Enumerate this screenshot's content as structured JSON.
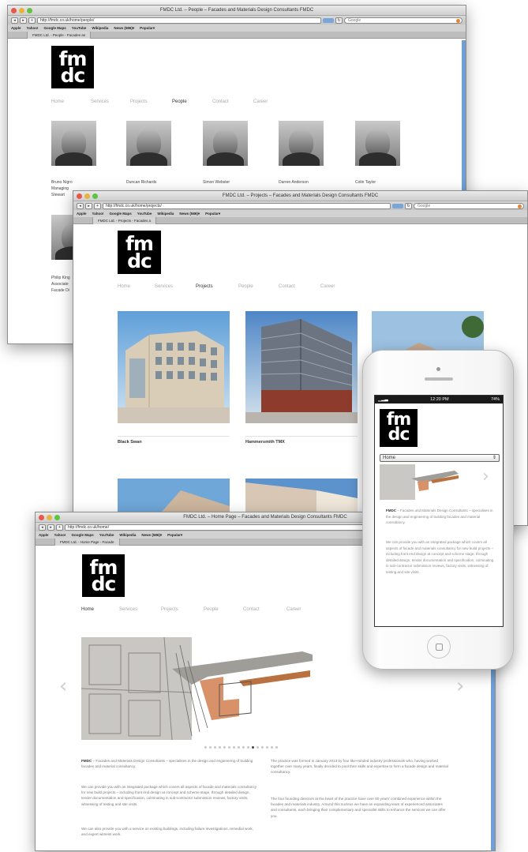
{
  "colors": {
    "scrollbar": "#6f9fd6",
    "logo_bg": "#000000",
    "nav_active": "#333333",
    "nav_inactive": "#aaaaaa"
  },
  "logo": {
    "line1": "fm",
    "line2": "dc"
  },
  "nav_items": [
    "Home",
    "Services",
    "Projects",
    "People",
    "Contact",
    "Career"
  ],
  "bookmarks": [
    "Apple",
    "Yahoo!",
    "Google Maps",
    "YouTube",
    "Wikipedia",
    "News (586)▾",
    "Popular▾"
  ],
  "people_window": {
    "title": "FMDC Ltd. – People – Facades and Materials Design Consultants FMDC",
    "url": "http://fmdc.co.uk/home/people/",
    "search_placeholder": "Google",
    "tab": "FMDC Ltd. - People - Facades an",
    "active_nav": "People",
    "people": [
      {
        "name": "Bruno Nigro",
        "role": "Managing",
        "extra": "Stewart"
      },
      {
        "name": "Duncan Richards"
      },
      {
        "name": "Simon Webster"
      },
      {
        "name": "Darren Anderson"
      },
      {
        "name": "Colin Taylor"
      }
    ],
    "second_row": {
      "name": "Philip King",
      "role": "Associate",
      "extra": "Facade Di"
    }
  },
  "projects_window": {
    "title": "FMDC Ltd. – Projects – Facades and Materials Design Consultants FMDC",
    "url": "http://fmdc.co.uk/home/projects/",
    "search_placeholder": "Google",
    "tab": "FMDC Ltd. - Projects - Facades a",
    "active_nav": "Projects",
    "projects": [
      "Black Swan",
      "Hammersmith TMX"
    ]
  },
  "home_window": {
    "title": "FMDC Ltd. – Home Page – Facades and Materials Design Consultants FMDC",
    "url": "http://fmdc.co.uk/home/",
    "tab": "FMDC Ltd. - Home Page - Facade",
    "active_nav": "Home",
    "slider_dots": 16,
    "active_dot": 10,
    "intro_lead": "FMDC",
    "intro": " – Facades and Materials Design Consultants – specialises in the design and engineering of building facades and material consultancy.",
    "para2": "We can provide you with an integrated package which covers all aspects of facade and materials consultancy for new build projects – including front end design at concept and scheme stage, through detailed design, tender documentation and specification, culminating in sub-contractor submission reviews, factory visits, witnessing of testing and site visits.",
    "para3": "We can also provide you with a service on existing buildings, including failure investigations, remedial work, and expert witness work.",
    "para4": "The practice was formed in January 2013 by four like-minded industry professionals who, having worked together over many years, finally decided to pool their skills and expertise to form a facade design and material consultancy.",
    "para5": "The four founding directors at the heart of the practice have over 80 years' combined experience within the facades and materials industry. Around this nucleus we have an expanding team of experienced associates and consultants, each bringing their complementary and specialist skills to enhance the services we can offer you."
  },
  "phone": {
    "time": "12:20 PM",
    "battery": "74%",
    "select_value": "Home",
    "intro_lead": "FMDC",
    "intro": " – Facades and Materials Design Consultants – specialises in the design and engineering of building facades and material consultancy.",
    "para2": "We can provide you with an integrated package which covers all aspects of facade and materials consultancy for new build projects – including front end design at concept and scheme stage, through detailed design, tender documentation and specification, culminating in sub-contractor submission reviews, factory visits, witnessing of testing and site visits."
  }
}
